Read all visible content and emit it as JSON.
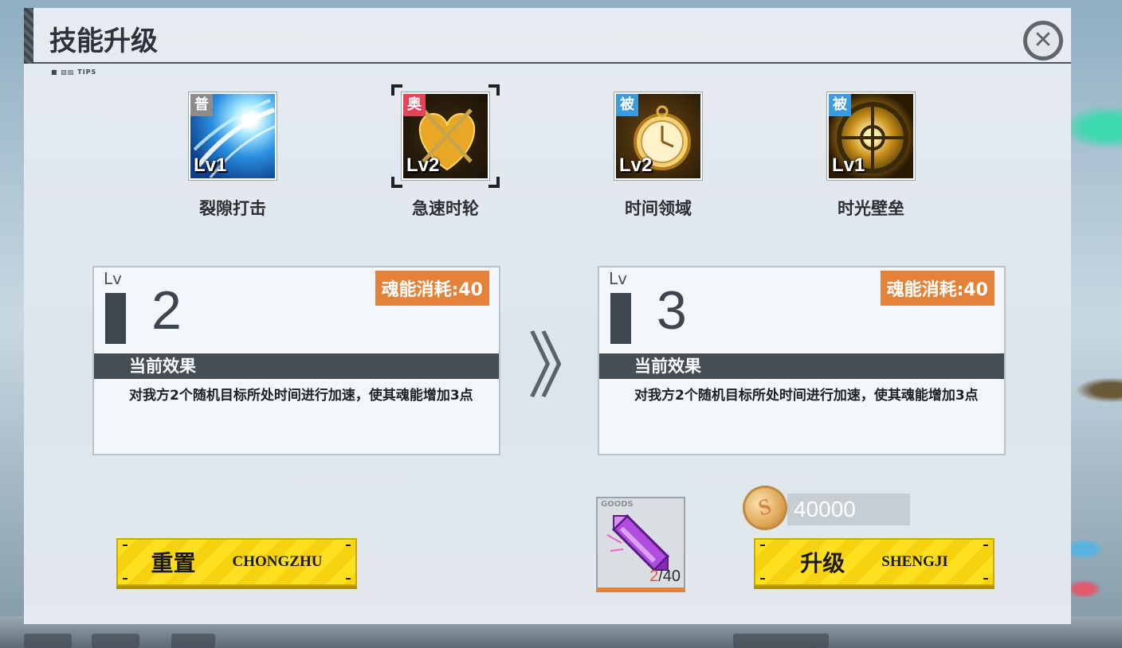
{
  "dialog": {
    "title": "技能升级",
    "tips": "TIPS"
  },
  "skills": [
    {
      "type": "普",
      "level": "Lv1",
      "name": "裂隙打击",
      "type_color": "#8c8c8c",
      "selected": false,
      "icon": "blue-slash-icon"
    },
    {
      "type": "奥",
      "level": "Lv2",
      "name": "急速时轮",
      "type_color": "#e0455a",
      "selected": true,
      "icon": "golden-heart-icon"
    },
    {
      "type": "被",
      "level": "Lv2",
      "name": "时间领域",
      "type_color": "#3a9be0",
      "selected": false,
      "icon": "pocket-watch-icon"
    },
    {
      "type": "被",
      "level": "Lv1",
      "name": "时光壁垒",
      "type_color": "#3a9be0",
      "selected": false,
      "icon": "crosshair-icon"
    }
  ],
  "current_card": {
    "lv_label": "Lv",
    "level": "2",
    "cost": "魂能消耗:40",
    "effect_title": "当前效果",
    "description": "对我方2个随机目标所处时间进行加速，使其魂能增加3点"
  },
  "next_card": {
    "lv_label": "Lv",
    "level": "3",
    "cost": "魂能消耗:40",
    "effect_title": "当前效果",
    "description": "对我方2个随机目标所处时间进行加速，使其魂能增加3点"
  },
  "arrow": "》",
  "reset_button": {
    "cn": "重置",
    "en": "CHONGZHU"
  },
  "upgrade_button": {
    "cn": "升级",
    "en": "SHENGJI"
  },
  "goods": {
    "tag": "GOODS",
    "current": "2",
    "required": "/40",
    "icon": "purple-crystal-icon"
  },
  "coin": {
    "amount": "40000",
    "symbol": "S"
  },
  "colors": {
    "accent_orange": "#e4823a",
    "button_yellow": "#ffe020",
    "dark_bar": "#454d55"
  }
}
